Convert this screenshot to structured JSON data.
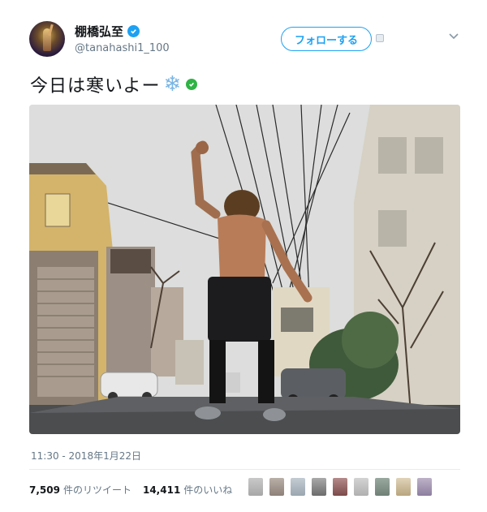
{
  "header": {
    "display_name": "棚橋弘至",
    "handle": "@tanahashi1_100",
    "follow_label": "フォローする"
  },
  "tweet": {
    "text": "今日は寒いよー",
    "emoji": "❄"
  },
  "footer": {
    "timestamp": "11:30 - 2018年1月22日",
    "retweets_count": "7,509",
    "retweets_label": "件のリツイート",
    "likes_count": "14,411",
    "likes_label": "件のいいね"
  },
  "colors": {
    "accent": "#1da1f2",
    "text": "#14171a",
    "muted": "#657786",
    "verified_green": "#2fb344"
  }
}
